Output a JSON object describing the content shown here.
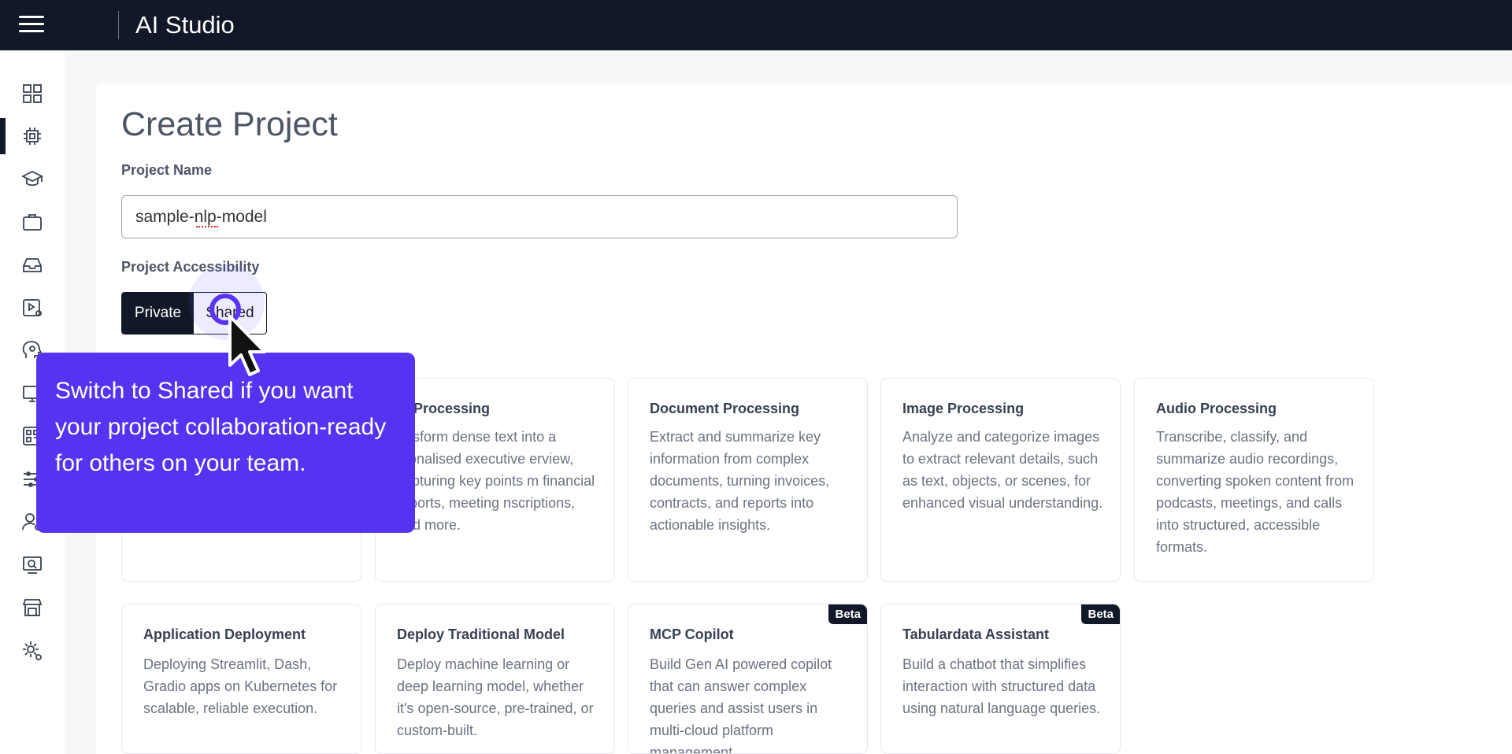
{
  "header": {
    "title": "AI Studio"
  },
  "sidebar": {
    "items": [
      {
        "icon": "grid-icon"
      },
      {
        "icon": "chip-icon",
        "active": true
      },
      {
        "icon": "graduation-cap-icon"
      },
      {
        "icon": "briefcase-icon"
      },
      {
        "icon": "inbox-tray-icon"
      },
      {
        "icon": "play-settings-icon"
      },
      {
        "icon": "head-gear-icon"
      },
      {
        "icon": "monitor-icon"
      },
      {
        "icon": "qr-code-icon"
      },
      {
        "icon": "sliders-icon"
      },
      {
        "icon": "user-settings-icon"
      },
      {
        "icon": "screen-search-icon"
      },
      {
        "icon": "store-icon"
      },
      {
        "icon": "gear-user-icon"
      }
    ]
  },
  "form": {
    "page_title": "Create Project",
    "name_label": "Project Name",
    "name_value": "sample-nlp-model",
    "access_label": "Project Accessibility",
    "access_options": [
      "Private",
      "Shared"
    ],
    "access_selected": "Private"
  },
  "tooltip": {
    "text": "Switch to Shared if you want your project collaboration-ready for others on your team."
  },
  "templates": [
    {
      "title": "xt Processing",
      "desc": "ansform dense text into a rsonalised executive erview, capturing key points m financial reports, meeting nscriptions, and more."
    },
    {
      "title": "Document Processing",
      "desc": "Extract and summarize key information from complex documents, turning invoices, contracts, and reports into actionable insights."
    },
    {
      "title": "Image Processing",
      "desc": "Analyze and categorize images to extract relevant details, such as text, objects, or scenes, for enhanced visual understanding."
    },
    {
      "title": "Audio Processing",
      "desc": "Transcribe, classify, and summarize audio recordings, converting spoken content from podcasts, meetings, and calls into structured, accessible formats."
    },
    {
      "title": "Application Deployment",
      "desc": "Deploying Streamlit, Dash, Gradio apps on Kubernetes for scalable, reliable execution."
    },
    {
      "title": "Deploy Traditional Model",
      "desc": "Deploy machine learning or deep learning model, whether it's open-source, pre-trained, or custom-built."
    },
    {
      "title": "MCP Copilot",
      "desc": "Build Gen AI powered copilot that can answer complex queries and assist users in multi-cloud platform management",
      "badge": "Beta"
    },
    {
      "title": "Tabulardata Assistant",
      "desc": "Build a chatbot that simplifies interaction with structured data using natural language queries.",
      "badge": "Beta"
    }
  ],
  "colors": {
    "topbar": "#111827",
    "accent": "#5533f0"
  }
}
